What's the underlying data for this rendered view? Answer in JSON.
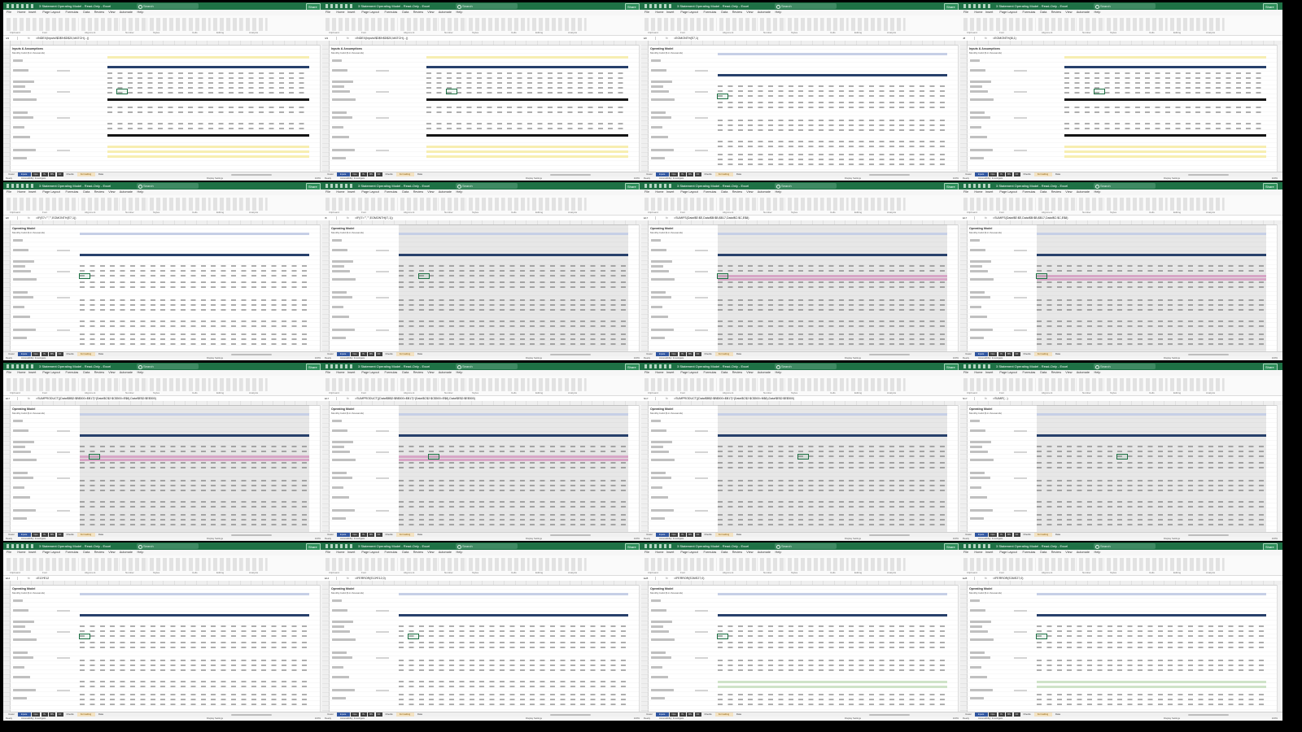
{
  "window": {
    "app_title": "3 Statement Operating Model - Read-Only - Excel",
    "search_placeholder": "Search",
    "share_label": "Share"
  },
  "menu": [
    "File",
    "Home",
    "Insert",
    "Page Layout",
    "Formulas",
    "Data",
    "Review",
    "View",
    "Automate",
    "Help"
  ],
  "ribbon_groups": [
    "Clipboard",
    "Font",
    "Alignment",
    "Number",
    "Styles",
    "Cells",
    "Editing",
    "Analysis"
  ],
  "tiles": [
    {
      "cell": "I23",
      "formula": "=INDEX(Inputs!$D$9:$D$20,MATCH(...))",
      "view": "inputs",
      "selected_col": 1
    },
    {
      "cell": "I23",
      "formula": "=INDEX(Inputs!$D$9:$D$20,MATCH(...))",
      "view": "inputs",
      "selected_col": 2
    },
    {
      "cell": "E8",
      "formula": "=EOMONTH(E7,1)",
      "view": "ops",
      "selected_col": 0
    },
    {
      "cell": "J8",
      "formula": "=EOMONTH(I8,1)",
      "view": "inputs",
      "selected_col": 3
    },
    {
      "cell": "E8",
      "formula": "=IF(E7=\"\",\"\",EOMONTH(E7,1))",
      "view": "ops",
      "selected_col": 0
    },
    {
      "cell": "I8",
      "formula": "=IF(I7=\"\",\"\",EOMONTH(I7,1))",
      "view": "ops-shaded",
      "selected_col": 2
    },
    {
      "cell": "E17",
      "formula": "=SUMIFS(Data!$E:$E,Data!$B:$B,$B17,Data!$C:$C,E$8)",
      "view": "ops-pink",
      "selected_col": 0
    },
    {
      "cell": "E17",
      "formula": "=SUMIFS(Data!$E:$E,Data!$B:$B,$B17,Data!$C:$C,E$8)",
      "view": "ops-pink",
      "selected_col": 0
    },
    {
      "cell": "E17",
      "formula": "=SUMPRODUCT((Data!$B$2:$B$500=$B17)*(Data!$C$2:$C$500=E$8),Data!$E$2:$E$500)",
      "view": "ops-pink",
      "selected_col": 1
    },
    {
      "cell": "E17",
      "formula": "=SUMPRODUCT((Data!$B$2:$B$500=$B17)*(Data!$C$2:$C$500=E$8),Data!$E$2:$E$500)",
      "view": "ops-pink",
      "selected_col": 3
    },
    {
      "cell": "N17",
      "formula": "=SUMPRODUCT((Data!$B$2:$B$500=$B17)*(Data!$C$2:$C$500=N$8),Data!$E$2:$E$500)",
      "view": "ops-shaded",
      "selected_col": 8
    },
    {
      "cell": "N17",
      "formula": "=SUMIF(...)",
      "view": "ops-shaded",
      "selected_col": 8
    },
    {
      "cell": "E14",
      "formula": "=E13*E12",
      "view": "ops",
      "selected_col": 0
    },
    {
      "cell": "E14",
      "formula": "=IFERROR(E13*E12,0)",
      "view": "ops",
      "selected_col": 1
    },
    {
      "cell": "E28",
      "formula": "=IFERROR(E26/E27,0)",
      "view": "ops-green",
      "selected_col": 0
    },
    {
      "cell": "E28",
      "formula": "=IFERROR(E26/E27,0)",
      "view": "ops-green",
      "selected_col": 0
    }
  ],
  "sheet_titles": {
    "inputs": "Inputs & Assumptions",
    "ops": "Operating Model",
    "subtitle": "Monthly build ($ in thousands)"
  },
  "sheet_tabs": [
    "Cover",
    "Inputs",
    "Ops",
    "IS",
    "BS",
    "CF",
    "Checks",
    "Formatting",
    "Data"
  ],
  "status": {
    "ready": "Ready",
    "accessibility": "Accessibility: Investigate",
    "display": "Display Settings",
    "zoom": "100%"
  },
  "colors": {
    "excel_green": "#1e7145",
    "navy_band": "#27406b",
    "selection": "#1e7145"
  }
}
